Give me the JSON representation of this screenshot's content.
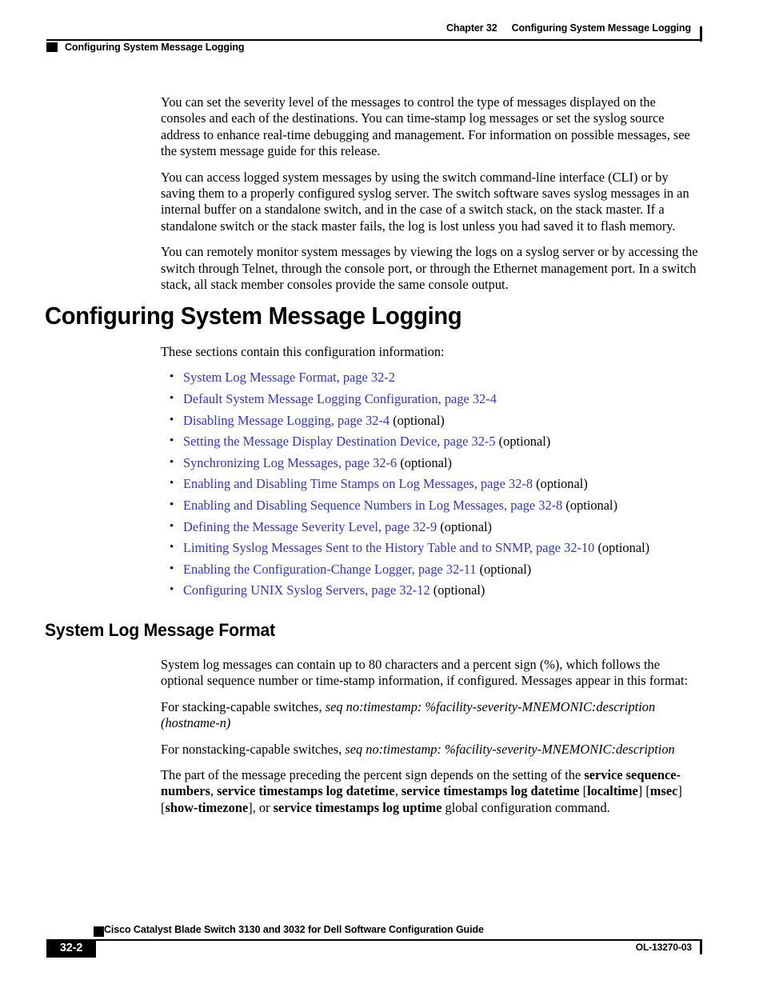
{
  "header": {
    "chapter_label": "Chapter 32",
    "chapter_title": "Configuring System Message Logging",
    "left_title": "Configuring System Message Logging"
  },
  "intro": {
    "paragraph_1": "You can set the severity level of the messages to control the type of messages displayed on the consoles and each of the destinations. You can time-stamp log messages or set the syslog source address to enhance real-time debugging and management. For information on possible messages, see the system message guide for this release.",
    "paragraph_2": "You can access logged system messages by using the switch command-line interface (CLI) or by saving them to a properly configured syslog server. The switch software saves syslog messages in an internal buffer on a standalone switch, and in the case of a switch stack, on the stack master. If a standalone switch or the stack master fails, the log is lost unless you had saved it to flash memory.",
    "paragraph_3": "You can remotely monitor system messages by viewing the logs on a syslog server or by accessing the switch through Telnet, through the console port, or through the Ethernet management port. In a switch stack, all stack member consoles provide the same console output."
  },
  "section_main": {
    "heading": "Configuring System Message Logging",
    "lead_in": "These sections contain this configuration information:",
    "links": [
      {
        "text": "System Log Message Format, page 32-2",
        "suffix": ""
      },
      {
        "text": "Default System Message Logging Configuration, page 32-4",
        "suffix": ""
      },
      {
        "text": "Disabling Message Logging, page 32-4",
        "suffix": " (optional)"
      },
      {
        "text": "Setting the Message Display Destination Device, page 32-5",
        "suffix": " (optional)"
      },
      {
        "text": "Synchronizing Log Messages, page 32-6",
        "suffix": " (optional)"
      },
      {
        "text": "Enabling and Disabling Time Stamps on Log Messages, page 32-8",
        "suffix": " (optional)"
      },
      {
        "text": "Enabling and Disabling Sequence Numbers in Log Messages, page 32-8",
        "suffix": " (optional)"
      },
      {
        "text": "Defining the Message Severity Level, page 32-9",
        "suffix": " (optional)"
      },
      {
        "text": "Limiting Syslog Messages Sent to the History Table and to SNMP, page 32-10",
        "suffix": " (optional)"
      },
      {
        "text": "Enabling the Configuration-Change Logger, page 32-11",
        "suffix": " (optional)"
      },
      {
        "text": "Configuring UNIX Syslog Servers, page 32-12",
        "suffix": " (optional)"
      }
    ],
    "link_color": "#3333cc"
  },
  "section_format": {
    "heading": "System Log Message Format",
    "paragraph_1": "System log messages can contain up to 80 characters and a percent sign (%), which follows the optional sequence number or time-stamp information, if configured. Messages appear in this format:",
    "stacking_prefix": "For stacking-capable switches, ",
    "stacking_format": "seq no:timestamp: %facility-severity-MNEMONIC:description (hostname-n)",
    "nonstacking_prefix": "For nonstacking-capable switches, ",
    "nonstacking_format": "seq no:timestamp: %facility-severity-MNEMONIC:description",
    "final_parts": {
      "t1": "The part of the message preceding the percent sign depends on the setting of the ",
      "cmd1": "service sequence-numbers",
      "t2": ", ",
      "cmd2": "service timestamps log datetime",
      "t3": ", ",
      "cmd3": "service timestamps log datetime",
      "t4": " [",
      "cmd4": "localtime",
      "t5": "] [",
      "cmd5": "msec",
      "t6": "] [",
      "cmd6": "show-timezone",
      "t7": "], or ",
      "cmd7": "service timestamps log uptime",
      "t8": " global configuration command."
    }
  },
  "footer": {
    "page_number": "32-2",
    "doc_title": "Cisco Catalyst Blade Switch 3130 and 3032 for Dell Software Configuration Guide",
    "doc_id": "OL-13270-03"
  }
}
